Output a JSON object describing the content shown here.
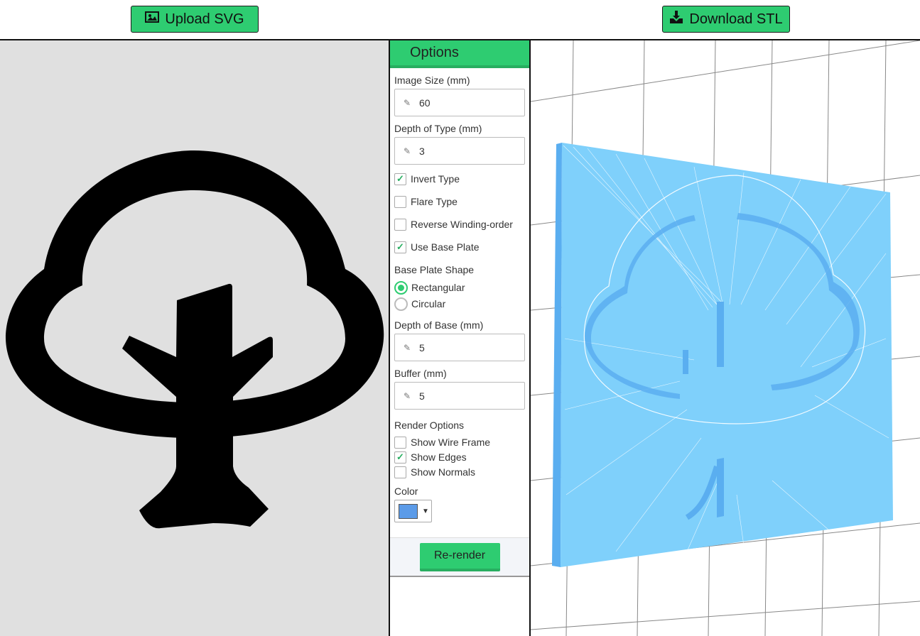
{
  "toolbar": {
    "upload_label": "Upload SVG",
    "download_label": "Download STL",
    "upload_icon": "image-icon",
    "download_icon": "download-icon",
    "accent_color": "#2ecc71"
  },
  "options": {
    "title": "Options",
    "image_size_label": "Image Size (mm)",
    "image_size_value": "60",
    "depth_type_label": "Depth of Type (mm)",
    "depth_type_value": "3",
    "invert_type_label": "Invert Type",
    "invert_type_checked": true,
    "flare_type_label": "Flare Type",
    "flare_type_checked": false,
    "reverse_winding_label": "Reverse Winding-order",
    "reverse_winding_checked": false,
    "use_base_plate_label": "Use Base Plate",
    "use_base_plate_checked": true,
    "base_plate_shape_label": "Base Plate Shape",
    "shape_rectangular_label": "Rectangular",
    "shape_circular_label": "Circular",
    "shape_selected": "Rectangular",
    "depth_base_label": "Depth of Base (mm)",
    "depth_base_value": "5",
    "buffer_label": "Buffer (mm)",
    "buffer_value": "5",
    "render_options_label": "Render Options",
    "wire_frame_label": "Show Wire Frame",
    "wire_frame_checked": false,
    "show_edges_label": "Show Edges",
    "show_edges_checked": true,
    "show_normals_label": "Show Normals",
    "show_normals_checked": false,
    "color_label": "Color",
    "color_value": "#5b9be8",
    "rerender_label": "Re-render"
  },
  "preview": {
    "background": "#e0e0e0",
    "shape": "tree-icon"
  },
  "viewport": {
    "model_color": "#7fd0fb",
    "grid_color": "#888888"
  }
}
